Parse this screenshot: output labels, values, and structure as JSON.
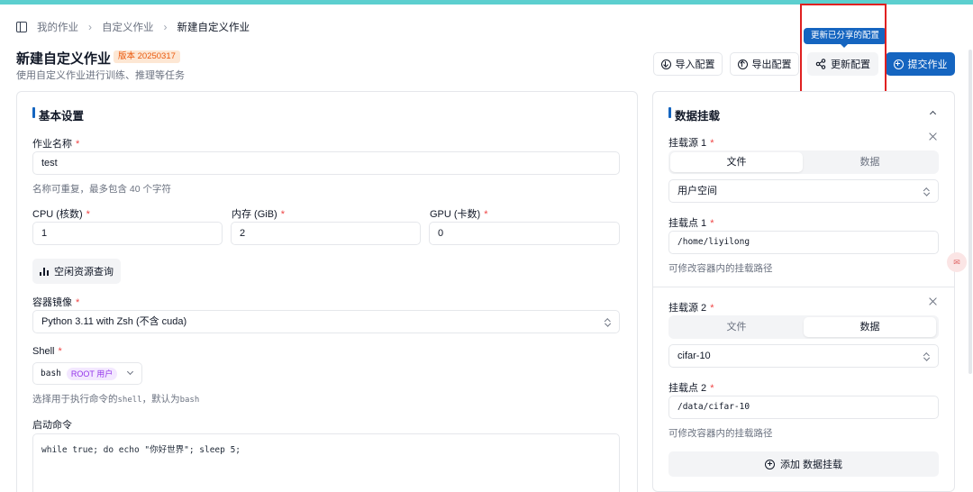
{
  "breadcrumb": {
    "items": [
      "我的作业",
      "自定义作业"
    ],
    "current": "新建自定义作业"
  },
  "header": {
    "title": "新建自定义作业",
    "version": "版本 20250317",
    "subtitle": "使用自定义作业进行训练、推理等任务",
    "buttons": {
      "import": "导入配置",
      "export": "导出配置",
      "update": "更新配置",
      "submit": "提交作业"
    },
    "tooltip": "更新已分享的配置"
  },
  "basic": {
    "title": "基本设置",
    "job_name": {
      "label": "作业名称",
      "value": "test",
      "hint": "名称可重复，最多包含 40 个字符"
    },
    "cpu": {
      "label": "CPU (核数)",
      "value": "1"
    },
    "memory": {
      "label": "内存 (GiB)",
      "value": "2"
    },
    "gpu": {
      "label": "GPU (卡数)",
      "value": "0"
    },
    "idle_button": "空闲资源查询",
    "image": {
      "label": "容器镜像",
      "value": "Python 3.11 with Zsh (不含 cuda)"
    },
    "shell": {
      "label": "Shell",
      "value": "bash",
      "badge": "ROOT 用户",
      "hint_prefix": "选择用于执行命令的",
      "hint_code1": "shell",
      "hint_mid": "，默认为",
      "hint_code2": "bash"
    },
    "command": {
      "label": "启动命令",
      "value": "while true; do echo \"你好世界\"; sleep 5;"
    }
  },
  "mount": {
    "title": "数据挂载",
    "sources": [
      {
        "label": "挂载源 1",
        "tabs": [
          "文件",
          "数据"
        ],
        "active": 0,
        "select": "用户空间",
        "point_label": "挂载点 1",
        "point": "/home/liyilong",
        "hint": "可修改容器内的挂载路径"
      },
      {
        "label": "挂载源 2",
        "tabs": [
          "文件",
          "数据"
        ],
        "active": 1,
        "select": "cifar-10",
        "point_label": "挂载点 2",
        "point": "/data/cifar-10",
        "hint": "可修改容器内的挂载路径"
      }
    ],
    "add_button": "添加 数据挂载"
  },
  "colors": {
    "primary": "#1565c0",
    "required": "#ef4444",
    "topbar": "#5ccfcf",
    "highlight": "#e02020"
  }
}
